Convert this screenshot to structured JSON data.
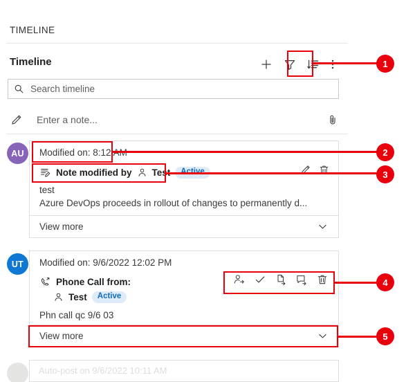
{
  "panel": {
    "section_header": "TIMELINE",
    "title": "Timeline",
    "toolbar": [
      {
        "name": "add-record-button",
        "icon": "plus-icon",
        "label": "+"
      },
      {
        "name": "filter-button",
        "icon": "filter-icon",
        "label": "Filter"
      },
      {
        "name": "sort-button",
        "icon": "sort-icon",
        "label": "Sort"
      },
      {
        "name": "more-commands-button",
        "icon": "more-vertical-icon",
        "label": "More commands"
      }
    ],
    "search": {
      "placeholder": "Search timeline",
      "value": "",
      "icon": "search-icon"
    },
    "note": {
      "placeholder": "Enter a note...",
      "value": "",
      "pencil_icon": "pencil-icon",
      "attach_icon": "paperclip-icon"
    }
  },
  "entries": [
    {
      "avatar_initials": "AU",
      "avatar_color": "#8764b8",
      "modified_on": "Modified on: 8:12 AM",
      "record_icon": "note-edit-icon",
      "subject": "Note modified by",
      "person_icon": "contact-icon",
      "person": "Test",
      "status_badge": "Active",
      "body_line_1": "test",
      "body_line_2": "Azure DevOps proceeds in rollout of changes to permanently d...",
      "view_more": "View more",
      "actions": [
        {
          "name": "edit-note-button",
          "icon": "pencil-icon"
        },
        {
          "name": "delete-note-button",
          "icon": "trash-icon"
        }
      ]
    },
    {
      "avatar_initials": "UT",
      "avatar_color": "#0f78d4",
      "modified_on": "Modified on: 9/6/2022 12:02 PM",
      "record_icon": "phone-call-icon",
      "subject": "Phone Call from:",
      "person_icon": "contact-icon",
      "person": "Test",
      "status_badge": "Active",
      "body_line_1": "Phn call qc 9/6 03",
      "view_more": "View more",
      "actions": [
        {
          "name": "assign-record-button",
          "icon": "assign-user-icon"
        },
        {
          "name": "mark-complete-button",
          "icon": "checkmark-icon"
        },
        {
          "name": "convert-to-case-button",
          "icon": "convert-document-icon"
        },
        {
          "name": "add-note-button",
          "icon": "reply-note-icon"
        },
        {
          "name": "delete-record-button",
          "icon": "trash-icon"
        }
      ]
    },
    {
      "avatar_initials": "",
      "modified_on": "Auto-post on 9/6/2022 10:11 AM",
      "faded": true
    }
  ],
  "annotations": {
    "accent_color": "#e8000d",
    "callouts": [
      {
        "number": "1",
        "target": "sort-button"
      },
      {
        "number": "2",
        "target": "modified-on-label"
      },
      {
        "number": "3",
        "target": "record-subject-line"
      },
      {
        "number": "4",
        "target": "record-action-bar"
      },
      {
        "number": "5",
        "target": "view-more-row"
      }
    ]
  }
}
